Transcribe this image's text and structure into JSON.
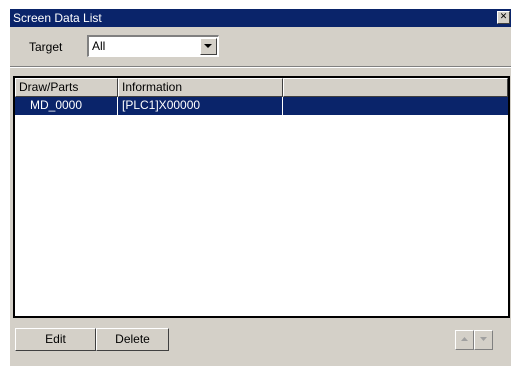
{
  "window": {
    "title": "Screen Data List",
    "close_icon": "close-icon"
  },
  "filter": {
    "label": "Target",
    "selected": "All"
  },
  "table": {
    "columns": [
      "Draw/Parts",
      "Information",
      ""
    ],
    "rows": [
      {
        "draw_parts": "MD_0000",
        "information": "[PLC1]X00000",
        "extra": "",
        "selected": true
      }
    ]
  },
  "actions": {
    "edit_label": "Edit",
    "delete_label": "Delete",
    "move_up_icon": "triangle-up-icon",
    "move_down_icon": "triangle-down-icon"
  },
  "colors": {
    "title_bar": "#0a246a",
    "selection": "#0a246a",
    "dialog_face": "#d4d0c8"
  }
}
